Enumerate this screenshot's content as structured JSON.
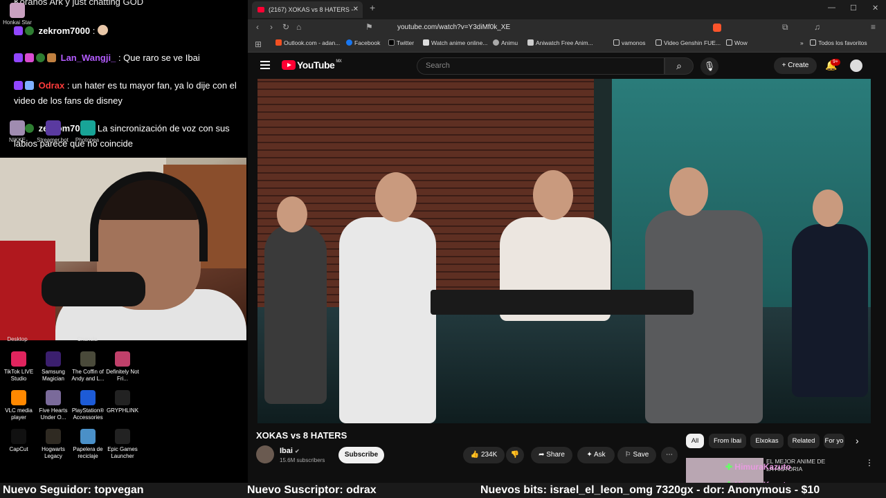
{
  "chat": {
    "top_partial": "Koranos Ark y just chatting GOD",
    "line1": {
      "user": "zekrom7000",
      "text": " : "
    },
    "line2": {
      "user": "Lan_Wangji_",
      "text": " : Que raro se ve Ibai"
    },
    "line3": {
      "user": "Odrax",
      "text": " : un hater es tu mayor fan, ya lo dije con el video de los fans de disney"
    },
    "line4": {
      "user": "zekrom7000",
      "text": " : La sincronización de voz con sus labios parece que no coincide"
    },
    "mini_labels": [
      "Honkai Star",
      "NIKKE",
      "Streamer.bot",
      "Photopea"
    ]
  },
  "desktop": {
    "top_cut": [
      "Desktop",
      "Chancla"
    ],
    "icons": [
      {
        "label": "TikTok LIVE Studio",
        "color": "#e0245e"
      },
      {
        "label": "Samsung Magician",
        "color": "#3b1f6e"
      },
      {
        "label": "The Coffin of Andy and L...",
        "color": "#4a4a3a"
      },
      {
        "label": "Definitely Not Fri...",
        "color": "#c0406a"
      },
      {
        "label": "VLC media player",
        "color": "#ff8800"
      },
      {
        "label": "Five Hearts Under O...",
        "color": "#7a6a9a"
      },
      {
        "label": "PlayStation® Accessories",
        "color": "#1d5bd6"
      },
      {
        "label": "GRYPHLINK",
        "color": "#222222"
      },
      {
        "label": "CapCut",
        "color": "#111111"
      },
      {
        "label": "Hogwarts Legacy",
        "color": "#2f2a22"
      },
      {
        "label": "Papelera de reciclaje",
        "color": "#4a90c8"
      },
      {
        "label": "Epic Games Launcher",
        "color": "#222222"
      }
    ]
  },
  "browser": {
    "tab_title": "(2167) XOKAS vs 8 HATERS -",
    "url": "youtube.com/watch?v=Y3diMf0k_XE",
    "bookmarks": [
      "Outlook.com - adan...",
      "Facebook",
      "Twitter",
      "Watch anime online...",
      "Animu",
      "Aniwatch Free Anim...",
      "vamonos",
      "Video Genshin FUE...",
      "Wow",
      "Todos los favoritos"
    ]
  },
  "youtube": {
    "logo": "YouTube",
    "region": "MX",
    "search_placeholder": "Search",
    "create": "Create",
    "notif_count": "9+",
    "video_title": "XOKAS vs 8 HATERS",
    "channel": "Ibai",
    "subscribers": "15.6M subscribers",
    "subscribe": "Subscribe",
    "likes": "234K",
    "share": "Share",
    "ask": "Ask",
    "save": "Save",
    "chips": [
      "All",
      "From Ibai",
      "Elxokas",
      "Related",
      "For yo"
    ],
    "rec_text": "EL MEJOR ANIME DE",
    "rec_sub": "LA HISTORIA",
    "overlay_user": "HimuraKazuto"
  },
  "ticker": {
    "follower": "Nuevo Seguidor: topvegan",
    "subscriber": "Nuevo Suscriptor: odrax",
    "bits": "Nuevos bits: israel_el_leon_omg 7320gx - dor: Anonymous - $10"
  },
  "colors": {
    "yt_red": "#ff0033",
    "twitch_purple": "#9146ff",
    "username_red": "#ff3b3b",
    "username_purple": "#b45cff"
  }
}
